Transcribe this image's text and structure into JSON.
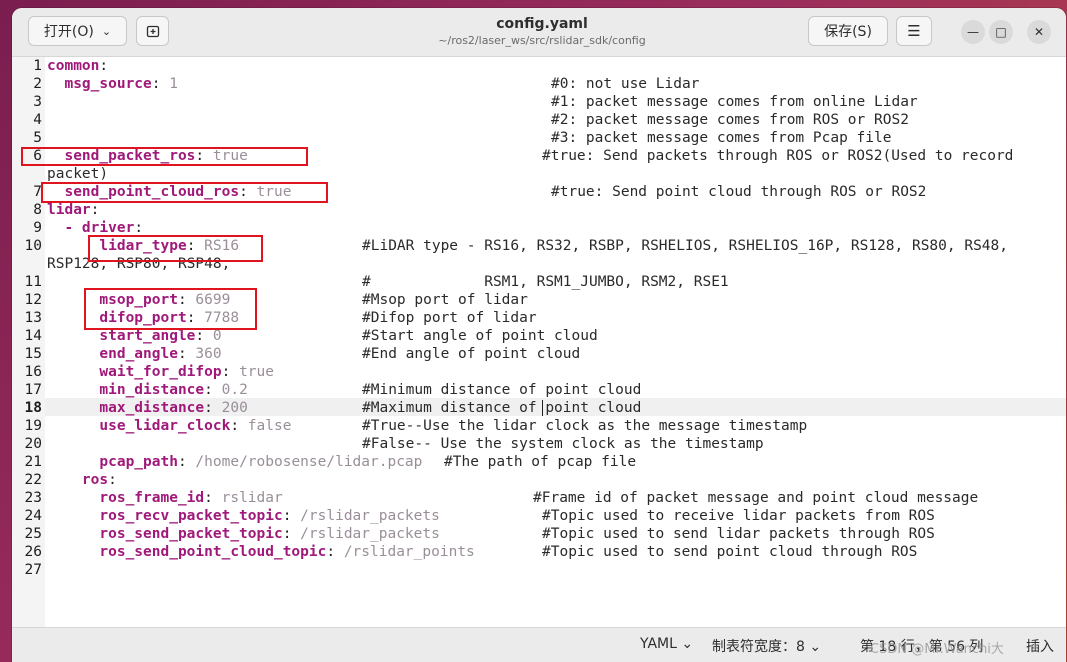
{
  "header": {
    "open_label": "打开(O)",
    "title": "config.yaml",
    "path": "~/ros2/laser_ws/src/rslidar_sdk/config",
    "save_label": "保存(S)",
    "icons": {
      "open_chevron": "chevron-down-icon",
      "new_tab": "new-tab-icon",
      "menu": "hamburger-menu-icon",
      "minimize": "minimize-icon",
      "maximize": "maximize-icon",
      "close": "close-icon"
    }
  },
  "editor": {
    "current_line": 18,
    "highlight_color": "#e0141e",
    "lines": {
      "l1": {
        "num": "1",
        "key": "common",
        "sep": ":",
        "val": "",
        "comment": ""
      },
      "l2": {
        "num": "2",
        "key": "  msg_source",
        "sep": ": ",
        "val": "1",
        "comment": "#0: not use Lidar"
      },
      "l3": {
        "num": "3",
        "key": "",
        "sep": "",
        "val": "",
        "comment": "#1: packet message comes from online Lidar"
      },
      "l4": {
        "num": "4",
        "key": "",
        "sep": "",
        "val": "",
        "comment": "#2: packet message comes from ROS or ROS2"
      },
      "l5": {
        "num": "5",
        "key": "",
        "sep": "",
        "val": "",
        "comment": "#3: packet message comes from Pcap file"
      },
      "l6": {
        "num": "6",
        "key": "  send_packet_ros",
        "sep": ": ",
        "val": "true",
        "comment": "#true: Send packets through ROS or ROS2(Used to record",
        "wrap": "packet)"
      },
      "l7": {
        "num": "7",
        "key": "  send_point_cloud_ros",
        "sep": ": ",
        "val": "true",
        "comment": "#true: Send point cloud through ROS or ROS2"
      },
      "l8": {
        "num": "8",
        "key": "lidar",
        "sep": ":",
        "val": "",
        "comment": ""
      },
      "l9": {
        "num": "9",
        "key": "  - driver",
        "sep": ":",
        "val": "",
        "comment": ""
      },
      "l10": {
        "num": "10",
        "key": "      lidar_type",
        "sep": ": ",
        "val": "RS16",
        "comment": "#LiDAR type - RS16, RS32, RSBP, RSHELIOS, RSHELIOS_16P, RS128, RS80, RS48,",
        "wrap": "RSP128, RSP80, RSP48,"
      },
      "l11": {
        "num": "11",
        "key": "",
        "sep": "",
        "val": "",
        "comment": "#             RSM1, RSM1_JUMBO, RSM2, RSE1"
      },
      "l12": {
        "num": "12",
        "key": "      msop_port",
        "sep": ": ",
        "val": "6699",
        "comment": "#Msop port of lidar"
      },
      "l13": {
        "num": "13",
        "key": "      difop_port",
        "sep": ": ",
        "val": "7788",
        "comment": "#Difop port of lidar"
      },
      "l14": {
        "num": "14",
        "key": "      start_angle",
        "sep": ": ",
        "val": "0",
        "comment": "#Start angle of point cloud"
      },
      "l15": {
        "num": "15",
        "key": "      end_angle",
        "sep": ": ",
        "val": "360",
        "comment": "#End angle of point cloud"
      },
      "l16": {
        "num": "16",
        "key": "      wait_for_difop",
        "sep": ": ",
        "val": "true",
        "comment": ""
      },
      "l17": {
        "num": "17",
        "key": "      min_distance",
        "sep": ": ",
        "val": "0.2",
        "comment": "#Minimum distance of point cloud"
      },
      "l18": {
        "num": "18",
        "key": "      max_distance",
        "sep": ": ",
        "val": "200",
        "comment": "#Maximum distance of point cloud"
      },
      "l19": {
        "num": "19",
        "key": "      use_lidar_clock",
        "sep": ": ",
        "val": "false",
        "comment": "#True--Use the lidar clock as the message timestamp"
      },
      "l20": {
        "num": "20",
        "key": "",
        "sep": "",
        "val": "",
        "comment": "#False-- Use the system clock as the timestamp"
      },
      "l21": {
        "num": "21",
        "key": "      pcap_path",
        "sep": ": ",
        "val": "/home/robosense/lidar.pcap",
        "comment": "#The path of pcap file"
      },
      "l22": {
        "num": "22",
        "key": "    ros",
        "sep": ":",
        "val": "",
        "comment": ""
      },
      "l23": {
        "num": "23",
        "key": "      ros_frame_id",
        "sep": ": ",
        "val": "rslidar",
        "comment": "#Frame id of packet message and point cloud message"
      },
      "l24": {
        "num": "24",
        "key": "      ros_recv_packet_topic",
        "sep": ": ",
        "val": "/rslidar_packets",
        "comment": "#Topic used to receive lidar packets from ROS"
      },
      "l25": {
        "num": "25",
        "key": "      ros_send_packet_topic",
        "sep": ": ",
        "val": "/rslidar_packets",
        "comment": "#Topic used to send lidar packets through ROS"
      },
      "l26": {
        "num": "26",
        "key": "      ros_send_point_cloud_topic",
        "sep": ": ",
        "val": "/rslidar_points",
        "comment": "#Topic used to send point cloud through ROS"
      },
      "l27": {
        "num": "27",
        "key": "",
        "sep": "",
        "val": "",
        "comment": ""
      }
    }
  },
  "status": {
    "language": "YAML",
    "tab_width": "制表符宽度：8",
    "position": "第 18 行，第 56 列",
    "mode": "插入",
    "watermark": "CSDN @Mr.Wanchi大"
  }
}
